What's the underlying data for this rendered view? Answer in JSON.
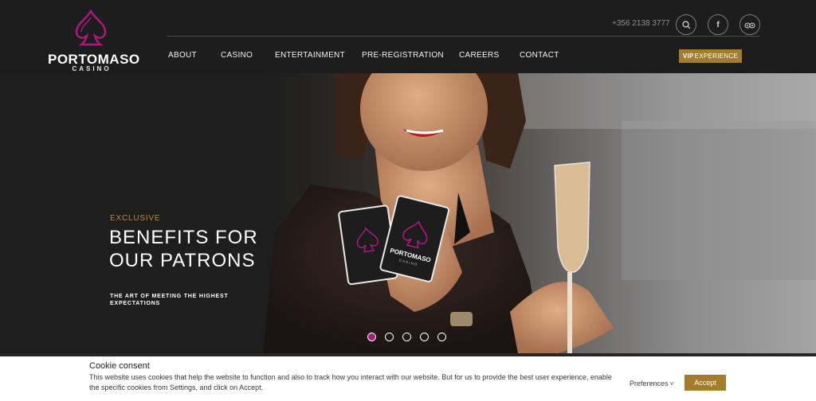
{
  "brand": {
    "name": "PORTOMASO",
    "sub": "CASINO",
    "accent": "#b0177c"
  },
  "header": {
    "phone": "+356 2138 3777",
    "icons": [
      "search-icon",
      "facebook-icon",
      "tripadvisor-icon"
    ],
    "nav": [
      "ABOUT",
      "CASINO",
      "ENTERTAINMENT",
      "PRE-REGISTRATION",
      "CAREERS",
      "CONTACT"
    ],
    "vip_bold": "VIP",
    "vip_rest": "EXPERIENCE",
    "vip_color": "#a57b2c"
  },
  "hero": {
    "eyebrow": "EXCLUSIVE",
    "headline_line1": "BENEFITS FOR",
    "headline_line2": "OUR PATRONS",
    "subline": "THE ART OF MEETING THE HIGHEST EXPECTATIONS",
    "card_text": "PORTOMASO",
    "card_sub": "CASINO",
    "slides_total": 5,
    "active_slide": 1
  },
  "cookie": {
    "title": "Cookie consent",
    "text": "This website uses cookies that help the website to function and also to track how you interact with our website. But for us to provide the best user experience, enable the specific cookies from Settings, and click on Accept.",
    "preferences": "Preferences",
    "accept": "Accept"
  }
}
